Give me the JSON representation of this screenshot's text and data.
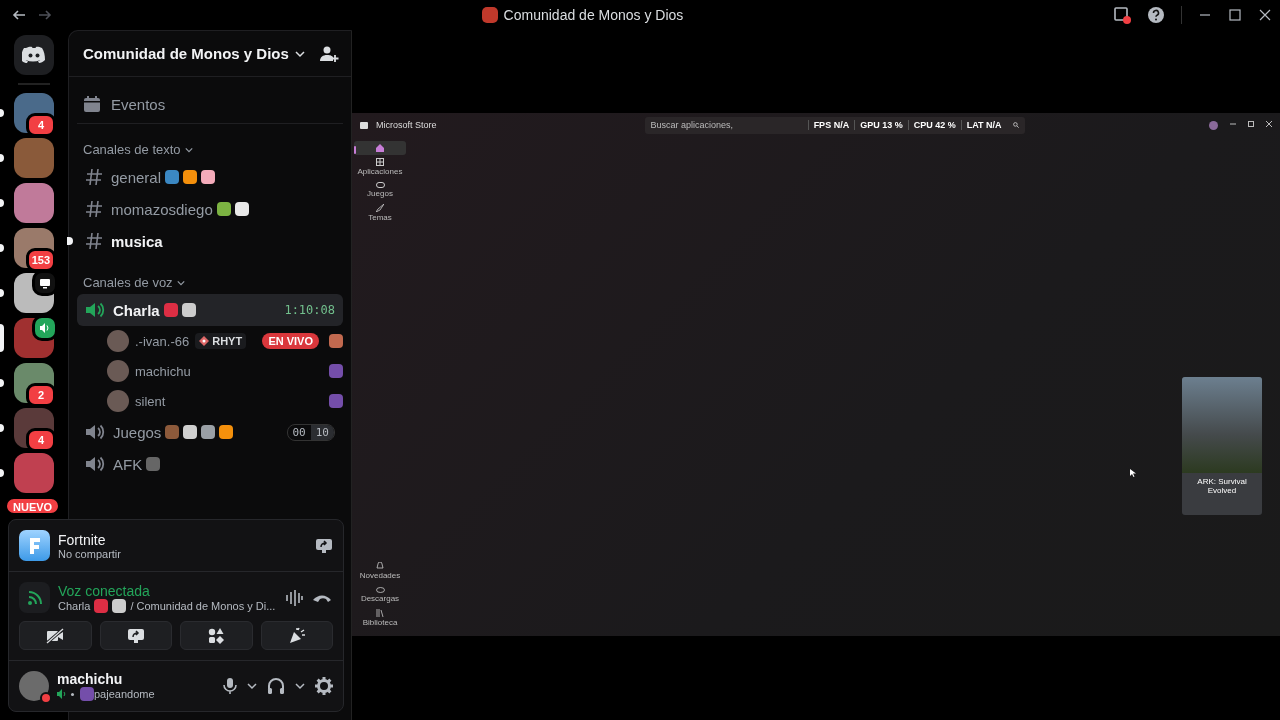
{
  "window": {
    "title": "Comunidad de Monos y Dios"
  },
  "servers": [
    {
      "kind": "count",
      "badge": "4",
      "selected": false
    },
    {
      "kind": "plain",
      "selected": false
    },
    {
      "kind": "plain",
      "selected": false
    },
    {
      "kind": "count",
      "badge": "153",
      "selected": false
    },
    {
      "kind": "screen",
      "selected": false
    },
    {
      "kind": "voice",
      "selected": true
    },
    {
      "kind": "count",
      "badge": "2",
      "selected": false
    },
    {
      "kind": "count",
      "badge": "4",
      "selected": false
    },
    {
      "kind": "new",
      "badge": "NUEVO",
      "selected": false
    }
  ],
  "server_header": {
    "name": "Comunidad de Monos y Dios"
  },
  "events": {
    "label": "Eventos"
  },
  "categories": [
    {
      "kind": "text",
      "label": "Canales de texto",
      "channels": [
        {
          "name": "general",
          "unread": false,
          "selected": false,
          "emojis": [
            {
              "color": "#3b88c3"
            },
            {
              "color": "#f4900c"
            },
            {
              "color": "#f4abba"
            }
          ]
        },
        {
          "name": "momazosdiego",
          "unread": false,
          "selected": false,
          "emojis": [
            {
              "color": "#7cb342"
            },
            {
              "color": "#e8e8e8"
            }
          ]
        },
        {
          "name": "musica",
          "unread": true,
          "selected": false
        }
      ]
    },
    {
      "kind": "voice",
      "label": "Canales de voz",
      "channels": [
        {
          "name": "Charla",
          "unread": false,
          "selected": true,
          "connected": true,
          "time": "1:10:08",
          "emojis": [
            {
              "color": "#dd2e44"
            },
            {
              "color": "#cccccc"
            }
          ],
          "members": [
            {
              "name": ".-ivan.-66",
              "tag": "RHYT",
              "live": "EN VIVO",
              "emojis": [
                {
                  "color": "#c1694f"
                }
              ]
            },
            {
              "name": "machichu",
              "emojis": [
                {
                  "color": "#744eaa"
                }
              ]
            },
            {
              "name": "silent",
              "emojis": [
                {
                  "color": "#744eaa"
                }
              ]
            }
          ]
        },
        {
          "name": "Juegos",
          "unread": false,
          "selected": false,
          "connected": false,
          "limit_used": "00",
          "limit_max": "10",
          "emojis": [
            {
              "color": "#8d5a3b"
            },
            {
              "color": "#cfcfcf"
            },
            {
              "color": "#9aa0a6"
            },
            {
              "color": "#f4900c"
            }
          ]
        },
        {
          "name": "AFK",
          "unread": false,
          "selected": false,
          "connected": false,
          "emojis": [
            {
              "color": "#666666"
            }
          ]
        }
      ]
    }
  ],
  "activity": {
    "game": "Fortnite",
    "status": "No compartir"
  },
  "voice": {
    "state": "Voz conectada",
    "channel": "Charla",
    "emojis": [
      {
        "color": "#dd2e44"
      },
      {
        "color": "#cccccc"
      }
    ],
    "path": "/ Comunidad de Monos y Di..."
  },
  "user": {
    "name": "machichu",
    "status": "pajeandome",
    "speaking": true,
    "emojis": [
      {
        "color": "#744eaa"
      }
    ]
  },
  "stream": {
    "app_title": "Microsoft Store",
    "search_placeholder": "Buscar aplicaciones,",
    "stats": [
      {
        "label": "FPS",
        "value": "N/A"
      },
      {
        "label": "GPU",
        "value": "13 %"
      },
      {
        "label": "CPU",
        "value": "42 %"
      },
      {
        "label": "LAT",
        "value": "N/A"
      }
    ],
    "nav_top": [
      {
        "kind": "home",
        "selected": true
      },
      {
        "kind": "apps",
        "label": "Aplicaciones",
        "selected": false
      },
      {
        "kind": "games",
        "label": "Juegos",
        "selected": false
      },
      {
        "kind": "themes",
        "label": "Temas",
        "selected": false
      }
    ],
    "nav_bottom": [
      {
        "kind": "news",
        "label": "Novedades",
        "selected": false
      },
      {
        "kind": "downloads",
        "label": "Descargas",
        "selected": false
      },
      {
        "kind": "library",
        "label": "Biblioteca",
        "selected": false
      }
    ],
    "card": {
      "title": "ARK: Survival Evolved"
    }
  }
}
